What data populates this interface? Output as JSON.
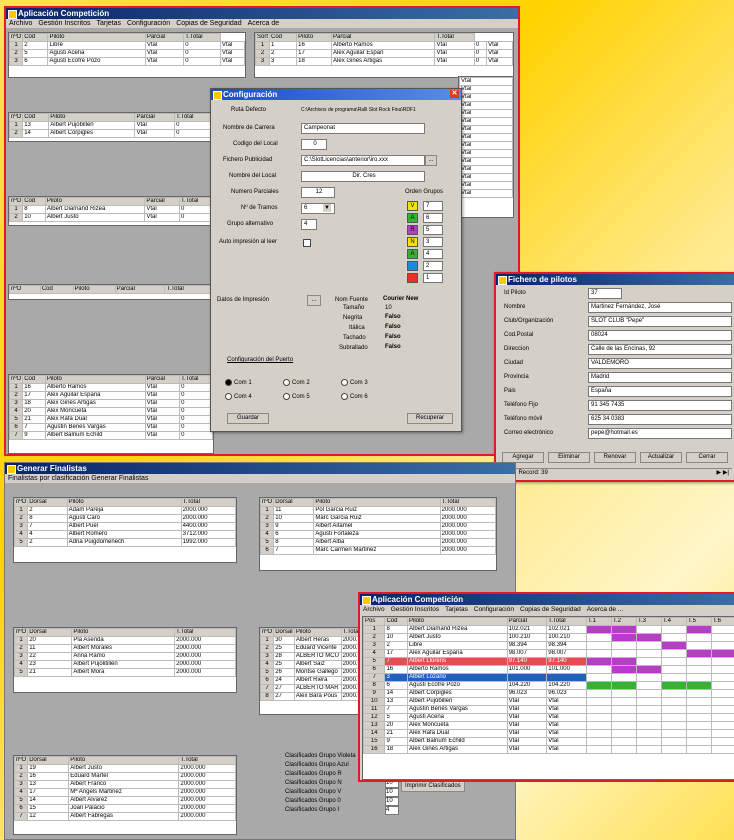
{
  "top_window": {
    "title": "Aplicación Competición",
    "menu": [
      "Archivo",
      "Gestión Inscritos",
      "Tarjetas",
      "Configuración",
      "Copias de Seguridad",
      "Acerca de"
    ],
    "grid_headers": [
      "nºO",
      "Cod",
      "Piloto",
      "Parcial",
      "T.Total"
    ],
    "grid_headers_r": [
      "Sort",
      "Cod",
      "Piloto",
      "Parcial",
      "T.Total"
    ],
    "group1_rows": [
      [
        "1",
        "2",
        "Libre",
        "Vtal",
        "0",
        "Vtal"
      ],
      [
        "2",
        "5",
        "Agusti Aceña",
        "Vtal",
        "0",
        "Vtal"
      ],
      [
        "3",
        "6",
        "Agusti Ecofre Pozo",
        "Vtal",
        "0",
        "Vtal"
      ]
    ],
    "group1r_rows": [
      [
        "1",
        "1",
        "16",
        "Alberto Ramos",
        "Vtal",
        "0",
        "Vtal"
      ],
      [
        "2",
        "2",
        "17",
        "Alex Aguilar Españ",
        "Vtal",
        "0",
        "Vtal"
      ],
      [
        "3",
        "3",
        "18",
        "Alex Ginés Artigas",
        "Vtal",
        "0",
        "Vtal"
      ]
    ],
    "group2_rows": [
      [
        "1",
        "13",
        "Albert Pujobillen",
        "Vtal",
        "0"
      ],
      [
        "2",
        "14",
        "Albert Corpigles",
        "Vtal",
        "0"
      ]
    ],
    "group3_rows": [
      [
        "1",
        "8",
        "Albert Diamand Rizea",
        "Vtal",
        "0"
      ],
      [
        "2",
        "10",
        "Albert Justo",
        "Vtal",
        "0"
      ]
    ],
    "group5_rows": [
      [
        "1",
        "16",
        "Alberto Ramos",
        "Vtal",
        "0"
      ],
      [
        "2",
        "17",
        "Alex Aguilar España",
        "Vtal",
        "0"
      ],
      [
        "3",
        "18",
        "Alex Ginés Artigas",
        "Vtal",
        "0"
      ],
      [
        "4",
        "20",
        "Alex Moncueta",
        "Vtal",
        "0"
      ],
      [
        "5",
        "21",
        "Alex Rafa Dual",
        "Vtal",
        "0"
      ],
      [
        "6",
        "7",
        "Agustin Benes Vargas",
        "Vtal",
        "0"
      ],
      [
        "7",
        "9",
        "Albert Balnum Echild",
        "Vtal",
        "0"
      ]
    ],
    "vtal_col": [
      "Vtal",
      "Vtal",
      "Vtal",
      "Vtal",
      "Vtal",
      "Vtal",
      "Vtal",
      "Vtal",
      "Vtal",
      "Vtal",
      "Vtal",
      "Vtal",
      "Vtal",
      "Vtal",
      "Vtal"
    ]
  },
  "config": {
    "title": "Configuración",
    "ruta_label": "Ruta Defecto",
    "ruta_value": "C:\\Archivos de programa\\Ralli Slot Rock Fina\\RDF1",
    "nombre_carrera_label": "Nombre de Carrera",
    "nombre_carrera_value": "Campeonat",
    "codigo_local_label": "Codigo del Local",
    "codigo_local_value": "0",
    "fichero_pub_label": "Fichero Publicidad",
    "fichero_pub_value": "C:\\SlotLicencias\\anterior\\iro.xxx",
    "nombre_local_label": "Nombre del Local",
    "nombre_local_value": "Dir. Cres",
    "num_parciales_label": "Numero Parciales",
    "num_parciales_value": "12",
    "tramos_label": "Nº de Tramos",
    "tramos_value": "6",
    "grupo_alt_label": "Grupo alternativo",
    "grupo_alt_value": "4",
    "auto_label": "Auto impresión al leer",
    "orden_label": "Orden Grupos",
    "orden": [
      {
        "letter": "V",
        "color": "#f4e400",
        "num": "7"
      },
      {
        "letter": "A",
        "color": "#32b432",
        "num": "6"
      },
      {
        "letter": "R",
        "color": "#b73cc8",
        "num": "5"
      },
      {
        "letter": "N",
        "color": "#f4e400",
        "num": "3"
      },
      {
        "letter": "A",
        "color": "#32b432",
        "num": "4"
      },
      {
        "letter": "",
        "color": "#1e8cd2",
        "num": "2"
      },
      {
        "letter": "",
        "color": "#e8321e",
        "num": "1"
      }
    ],
    "datos_label": "Datos de Impresión",
    "font_label": "Nom Fuente",
    "font_value": "Courier New",
    "size_label": "Tamaño",
    "size_value": "10",
    "bold_label": "Negrita",
    "bold_value": "Falso",
    "italic_label": "Itálica",
    "italic_value": "Falso",
    "strike_label": "Tachado",
    "strike_value": "Falso",
    "under_label": "Subrallado",
    "under_value": "Falso",
    "puerto_label": "Configuración del Puerto",
    "coms": [
      "Com 1",
      "Com 2",
      "Com 3",
      "Com 4",
      "Com 5",
      "Com 6"
    ],
    "save_label": "Guardar",
    "recover_label": "Recuperar"
  },
  "fichero": {
    "title": "Fichero de pilotos",
    "fields": [
      {
        "label": "Id Piloto",
        "value": "37"
      },
      {
        "label": "Nombre",
        "value": "Martinez Fernández, José"
      },
      {
        "label": "Club/Organización",
        "value": "SLOT CLUB \"Pepe\""
      },
      {
        "label": "Cod.Postal",
        "value": "08024"
      },
      {
        "label": "Direccion",
        "value": "Calle de las Encinas, 92"
      },
      {
        "label": "Ciudad",
        "value": "VALDEMORO"
      },
      {
        "label": "Provincia",
        "value": "Madrid"
      },
      {
        "label": "Pais",
        "value": "España"
      },
      {
        "label": "Teléfono Fijo",
        "value": "91 345 7435"
      },
      {
        "label": "Teléfono móvil",
        "value": "625 34 0383"
      },
      {
        "label": "Correo electrónico",
        "value": "pepe@hotmail.es"
      }
    ],
    "buttons": [
      "Agregar",
      "Eliminar",
      "Renovar",
      "Actualizar",
      "Cerrar"
    ],
    "record": "Record: 39"
  },
  "ganers": {
    "title": "Generar Finalistas",
    "sub": "Finalistas por clasificación   Generar Finalistas",
    "headers": [
      "nºO",
      "Dorsal",
      "Piloto",
      "T.Total"
    ],
    "g1": [
      [
        "1",
        "2",
        "Adam Pareja",
        "2000.000"
      ],
      [
        "2",
        "8",
        "Agusti Caro",
        "2000.000"
      ],
      [
        "3",
        "7",
        "Albert Puel",
        "4400.000"
      ],
      [
        "4",
        "4",
        "Albert Romero",
        "3712.000"
      ],
      [
        "5",
        "2",
        "Adria Puigdomenech",
        "1992.000"
      ]
    ],
    "g2": [
      [
        "1",
        "11",
        "Pol Garcia Ruiz",
        "2000.000"
      ],
      [
        "2",
        "10",
        "Marc Garcia Ruiz",
        "2000.000"
      ],
      [
        "3",
        "9",
        "Albert Aitamel",
        "2000.000"
      ],
      [
        "4",
        "6",
        "Agusti Fortaleza",
        "2000.000"
      ],
      [
        "5",
        "8",
        "Albert Alba",
        "2000.000"
      ],
      [
        "6",
        "7",
        "Marc Carmen Martinez",
        "2000.000"
      ]
    ],
    "g3": [
      [
        "1",
        "20",
        "Pla Asenda",
        "2000.000"
      ],
      [
        "2",
        "11",
        "Albert Morales",
        "2000.000"
      ],
      [
        "3",
        "22",
        "Anna Ramo",
        "2000.000"
      ],
      [
        "4",
        "23",
        "Albert Pujolitillen",
        "2000.000"
      ],
      [
        "5",
        "21",
        "Albert Mora",
        "2000.000"
      ]
    ],
    "g4": [
      [
        "1",
        "30",
        "Albert Heras",
        "2000.000"
      ],
      [
        "2",
        "25",
        "Eduard Vicente",
        "2000.000"
      ],
      [
        "3",
        "28",
        "ALBERTO MCU",
        "2000.000"
      ],
      [
        "4",
        "25",
        "Albert Saiz",
        "2000.000"
      ],
      [
        "5",
        "26",
        "Montse Gallego",
        "2000.000"
      ],
      [
        "6",
        "24",
        "Albert Riera",
        "2000.000"
      ],
      [
        "7",
        "27",
        "ALBERTO MAR",
        "2000.000"
      ],
      [
        "8",
        "27",
        "Alex Bara Pous",
        "2000.000"
      ]
    ],
    "g5": [
      [
        "1",
        "19",
        "Albert Justo",
        "2000.000"
      ],
      [
        "2",
        "16",
        "Eduard Martel",
        "2000.000"
      ],
      [
        "3",
        "13",
        "Albert Franco",
        "2000.000"
      ],
      [
        "4",
        "17",
        "Mª Angels Martinez",
        "2000.000"
      ],
      [
        "5",
        "14",
        "Albert Alvarez",
        "2000.000"
      ],
      [
        "6",
        "15",
        "Joan Palacio",
        "2000.000"
      ],
      [
        "7",
        "12",
        "Albert Fabregas",
        "2000.000"
      ]
    ],
    "clasif_labels": [
      "Clasificados Grupo Violeta",
      "Clasificados Grupo Azul",
      "Clasificados Grupo R",
      "Clasificados Grupo N",
      "Clasificados Grupo V",
      "Clasificados Grupo 0",
      "Clasificados Grupo I"
    ],
    "clasif_values": [
      "5",
      "5",
      "5",
      "10",
      "10",
      "10",
      "4"
    ],
    "print_label": "Imprimir Clasificados"
  },
  "results": {
    "title": "Aplicación Competición",
    "menu": [
      "Archivo",
      "Gestión Inscritos",
      "Tarjetas",
      "Configuración",
      "Copias de Seguridad",
      "Acerca de ..."
    ],
    "headers": [
      "Pos",
      "Cod",
      "Piloto",
      "Parcial",
      "T.Total",
      "T.1",
      "T.2",
      "T.3",
      "T.4",
      "T.5",
      "T.6"
    ],
    "rows": [
      {
        "pos": "1",
        "cod": "8",
        "name": "Albert Diamand Rizea",
        "parcial": "102.021",
        "t": "102.021",
        "c": [
          "#b73cc8",
          "#b73cc8",
          "#fff",
          "#fff",
          "#b73cc8",
          "#fff"
        ],
        "hl": ""
      },
      {
        "pos": "2",
        "cod": "10",
        "name": "Albert Justo",
        "parcial": "100.210",
        "t": "100.210",
        "c": [
          "#fff",
          "#b73cc8",
          "#b73cc8",
          "#fff",
          "#fff",
          "#fff"
        ],
        "hl": ""
      },
      {
        "pos": "3",
        "cod": "2",
        "name": "Libre",
        "parcial": "98.394",
        "t": "98.394",
        "c": [
          "#fff",
          "#fff",
          "#fff",
          "#b73cc8",
          "#fff",
          "#fff"
        ],
        "hl": ""
      },
      {
        "pos": "4",
        "cod": "17",
        "name": "Alex Aguilar España",
        "parcial": "98.007",
        "t": "98.007",
        "c": [
          "#fff",
          "#fff",
          "#fff",
          "#fff",
          "#b73cc8",
          "#b73cc8"
        ],
        "hl": ""
      },
      {
        "pos": "5",
        "cod": "7",
        "name": "Albert Llorens",
        "parcial": "97.140",
        "t": "97.140",
        "c": [
          "#b73cc8",
          "#b73cc8",
          "#fff",
          "#fff",
          "#fff",
          "#fff"
        ],
        "hl": "#e05050"
      },
      {
        "pos": "6",
        "cod": "16",
        "name": "Alberto Ramos",
        "parcial": "101.000",
        "t": "101.000",
        "c": [
          "#fff",
          "#b73cc8",
          "#b73cc8",
          "#fff",
          "#fff",
          "#fff"
        ],
        "hl": ""
      },
      {
        "pos": "7",
        "cod": "3",
        "name": "Albert Lozano",
        "parcial": "",
        "t": "",
        "c": [
          "#fff",
          "#fff",
          "#fff",
          "#fff",
          "#fff",
          "#fff"
        ],
        "hl": "#2060c0"
      },
      {
        "pos": "8",
        "cod": "6",
        "name": "Agusti Ecofre Pozo",
        "parcial": "104.220",
        "t": "104.220",
        "c": [
          "#32b432",
          "#32b432",
          "#fff",
          "#32b432",
          "#32b432",
          "#fff"
        ],
        "hl": ""
      },
      {
        "pos": "9",
        "cod": "14",
        "name": "Albert Corpigles",
        "parcial": "96.023",
        "t": "96.023",
        "c": [
          "#fff",
          "#fff",
          "#fff",
          "#fff",
          "#fff",
          "#fff"
        ],
        "hl": ""
      },
      {
        "pos": "10",
        "cod": "13",
        "name": "Albert Pujobillen",
        "parcial": "Vtal",
        "t": "Vtal",
        "c": [
          "#fff",
          "#fff",
          "#fff",
          "#fff",
          "#fff",
          "#fff"
        ],
        "hl": ""
      },
      {
        "pos": "11",
        "cod": "7",
        "name": "Agustin Benes Vargas",
        "parcial": "Vtal",
        "t": "Vtal",
        "c": [
          "#fff",
          "#fff",
          "#fff",
          "#fff",
          "#fff",
          "#fff"
        ],
        "hl": ""
      },
      {
        "pos": "12",
        "cod": "5",
        "name": "Agusti Aceña",
        "parcial": "Vtal",
        "t": "Vtal",
        "c": [
          "#fff",
          "#fff",
          "#fff",
          "#fff",
          "#fff",
          "#fff"
        ],
        "hl": ""
      },
      {
        "pos": "13",
        "cod": "20",
        "name": "Alex Moncueta",
        "parcial": "Vtal",
        "t": "Vtal",
        "c": [
          "#fff",
          "#fff",
          "#fff",
          "#fff",
          "#fff",
          "#fff"
        ],
        "hl": ""
      },
      {
        "pos": "14",
        "cod": "21",
        "name": "Alex Rafa Dual",
        "parcial": "Vtal",
        "t": "Vtal",
        "c": [
          "#fff",
          "#fff",
          "#fff",
          "#fff",
          "#fff",
          "#fff"
        ],
        "hl": ""
      },
      {
        "pos": "15",
        "cod": "9",
        "name": "Albert Balnum Echild",
        "parcial": "Vtal",
        "t": "Vtal",
        "c": [
          "#fff",
          "#fff",
          "#fff",
          "#fff",
          "#fff",
          "#fff"
        ],
        "hl": ""
      },
      {
        "pos": "16",
        "cod": "18",
        "name": "Alex Ginés Artigas",
        "parcial": "Vtal",
        "t": "Vtal",
        "c": [
          "#fff",
          "#fff",
          "#fff",
          "#fff",
          "#fff",
          "#fff"
        ],
        "hl": ""
      }
    ]
  }
}
